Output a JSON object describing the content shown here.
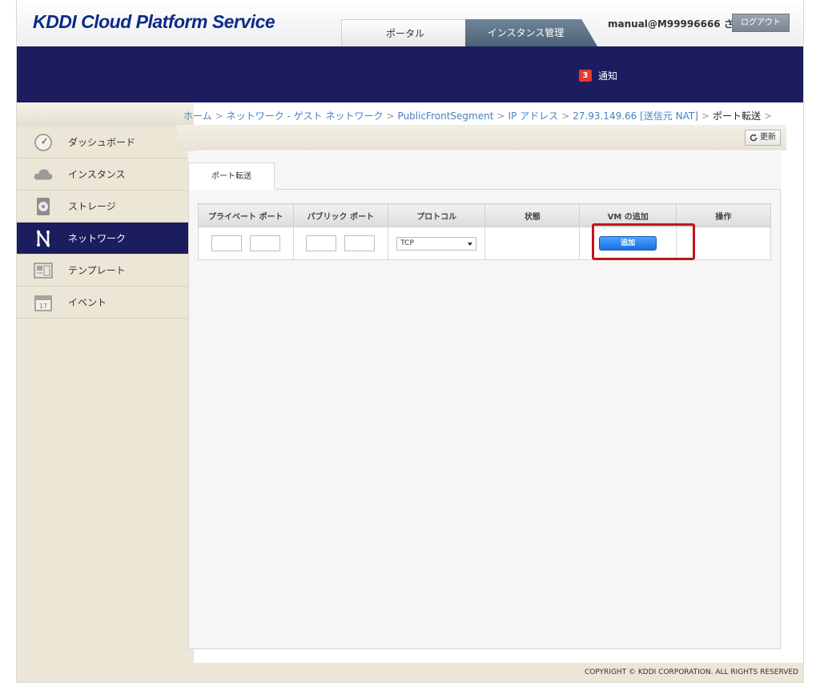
{
  "header": {
    "logo": "KDDI Cloud Platform Service",
    "tabs": [
      {
        "label": "ポータル",
        "active": false
      },
      {
        "label": "インスタンス管理",
        "active": true
      }
    ],
    "user": "manual@M99996666 さん",
    "logout_label": "ログアウト"
  },
  "notifications": {
    "count": "3",
    "label": "通知"
  },
  "sidebar": {
    "items": [
      {
        "label": "ダッシュボード",
        "icon": "dashboard-icon",
        "active": false
      },
      {
        "label": "インスタンス",
        "icon": "cloud-icon",
        "active": false
      },
      {
        "label": "ストレージ",
        "icon": "storage-icon",
        "active": false
      },
      {
        "label": "ネットワーク",
        "icon": "network-icon",
        "active": true
      },
      {
        "label": "テンプレート",
        "icon": "template-icon",
        "active": false
      },
      {
        "label": "イベント",
        "icon": "calendar-icon",
        "active": false
      }
    ]
  },
  "breadcrumb": {
    "items": [
      "ホーム",
      "ネットワーク - ゲスト ネットワーク",
      "PublicFrontSegment",
      "IP アドレス",
      "27.93.149.66 [送信元 NAT]"
    ],
    "current": "ポート転送"
  },
  "toolbar": {
    "refresh_label": "更新"
  },
  "panel": {
    "tab_label": "ポート転送",
    "columns": [
      "プライベート ポート",
      "パブリック ポート",
      "プロトコル",
      "状態",
      "VM の追加",
      "操作"
    ],
    "protocol_selected": "TCP",
    "add_label": "追加"
  },
  "footer": {
    "copyright": "COPYRIGHT © KDDI CORPORATION. ALL RIGHTS RESERVED"
  },
  "colors": {
    "navy": "#1b1d5e",
    "accent_blue": "#1b6fe0",
    "highlight_red": "#c0141a",
    "sidebar_bg": "#ebe6d6"
  }
}
